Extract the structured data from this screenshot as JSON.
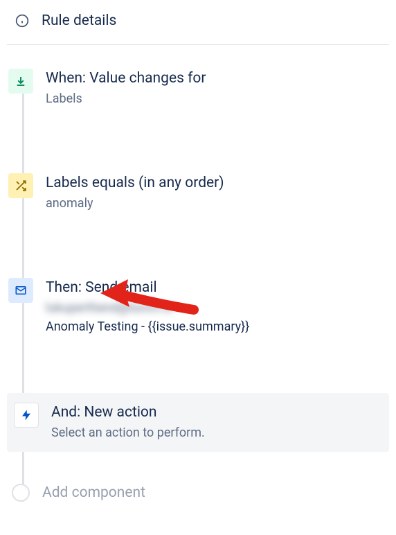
{
  "header": {
    "title": "Rule details"
  },
  "steps": {
    "when": {
      "title": "When: Value changes for",
      "subtitle": "Labels"
    },
    "condition": {
      "title": "Labels equals (in any order)",
      "subtitle": "anomaly"
    },
    "then": {
      "title": "Then: Send email",
      "redacted_recipient": "lukuperthend@lunch.io",
      "subject": "Anomaly Testing - {{issue.summary}}"
    },
    "newAction": {
      "title": "And: New action",
      "subtitle": "Select an action to perform."
    }
  },
  "addComponent": {
    "label": "Add component"
  }
}
